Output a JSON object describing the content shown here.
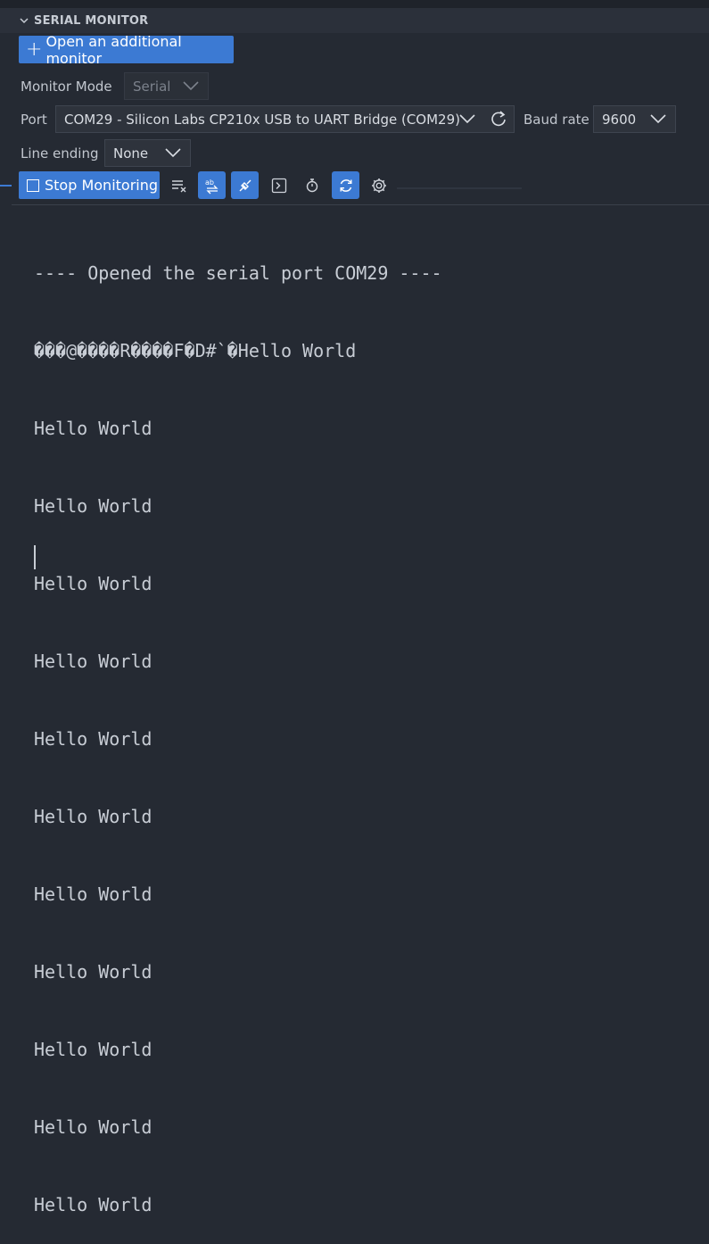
{
  "panel": {
    "title": "SERIAL MONITOR"
  },
  "actions": {
    "open_monitor_label": "Open an additional monitor"
  },
  "monitor_mode": {
    "label": "Monitor Mode",
    "value": "Serial"
  },
  "port": {
    "label": "Port",
    "value": "COM29 - Silicon Labs CP210x USB to UART Bridge (COM29)"
  },
  "baud": {
    "label": "Baud rate",
    "value": "9600"
  },
  "line_ending": {
    "label": "Line ending",
    "value": "None"
  },
  "toolbar": {
    "stop_label": "Stop Monitoring"
  },
  "console": {
    "lines": [
      "---- Opened the serial port COM29 ----",
      "���@����R����F�D#`�Hello World",
      "Hello World",
      "Hello World",
      "Hello World",
      "Hello World",
      "Hello World",
      "Hello World",
      "Hello World",
      "Hello World",
      "Hello World",
      "Hello World",
      "Hello World"
    ]
  },
  "colors": {
    "accent": "#3c7ad3",
    "background": "#252a33",
    "header": "#2b303a"
  }
}
